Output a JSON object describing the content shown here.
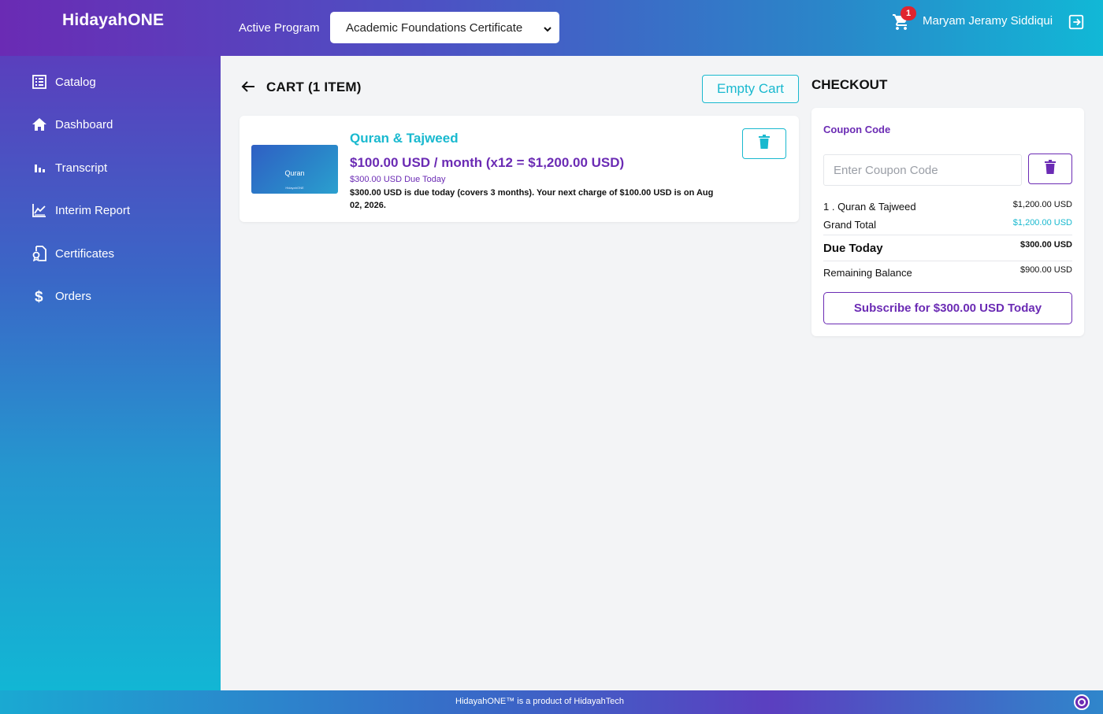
{
  "app": {
    "logo": "HidayahONE"
  },
  "header": {
    "active_program_label": "Active Program",
    "active_program_value": "Academic Foundations Certificate",
    "cart_count": "1",
    "user_name": "Maryam Jeramy Siddiqui",
    "icons": {
      "cart": "cart-icon",
      "logout": "logout-icon",
      "dropdown": "chevron-down-icon"
    }
  },
  "sidebar": {
    "items": [
      {
        "label": "Catalog",
        "icon": "catalog-icon"
      },
      {
        "label": "Dashboard",
        "icon": "home-icon"
      },
      {
        "label": "Transcript",
        "icon": "bar-chart-icon"
      },
      {
        "label": "Interim Report",
        "icon": "line-chart-icon"
      },
      {
        "label": "Certificates",
        "icon": "certificate-icon"
      },
      {
        "label": "Orders",
        "icon": "dollar-icon"
      }
    ]
  },
  "cart": {
    "title": "CART (1 ITEM)",
    "empty_button": "Empty Cart",
    "items": [
      {
        "thumbnail_title": "Quran",
        "thumbnail_sub": "HidayahONE",
        "name": "Quran & Tajweed",
        "price_line": "$100.00 USD / month (x12 = $1,200.00 USD)",
        "due_today": "$300.00 USD Due Today",
        "note": "$300.00 USD is due today (covers 3 months). Your next charge of $100.00 USD is on Aug 02, 2026."
      }
    ]
  },
  "checkout": {
    "title": "CHECKOUT",
    "coupon_label": "Coupon Code",
    "coupon_placeholder": "Enter Coupon Code",
    "line_item_label": "1 . Quran & Tajweed",
    "line_item_value": "$1,200.00 USD",
    "grand_total_label": "Grand Total",
    "grand_total_value": "$1,200.00 USD",
    "due_today_label": "Due Today",
    "due_today_value": "$300.00 USD",
    "remaining_label": "Remaining Balance",
    "remaining_value": "$900.00 USD",
    "subscribe_button": "Subscribe for $300.00 USD Today"
  },
  "footer": {
    "text": "HidayahONE™ is a product of HidayahTech"
  },
  "colors": {
    "accent_cyan": "#19b9cf",
    "accent_purple": "#6b2bb4",
    "badge_red": "#e0242f"
  }
}
